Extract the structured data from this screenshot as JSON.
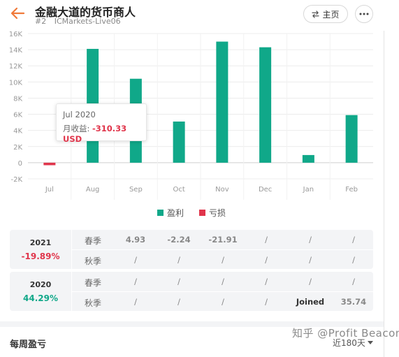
{
  "header": {
    "title": "金融大道的货币商人",
    "rank": "#2",
    "server": "ICMarkets-Live06",
    "home_label": "主页"
  },
  "chart_data": {
    "type": "bar",
    "categories": [
      "Jul",
      "Aug",
      "Sep",
      "Oct",
      "Nov",
      "Dec",
      "Jan",
      "Feb"
    ],
    "values": [
      -310.33,
      14100,
      10400,
      5100,
      15000,
      14300,
      950,
      5900
    ],
    "ylim": [
      -2000,
      16000
    ],
    "yticks": [
      16000,
      14000,
      12000,
      10000,
      8000,
      6000,
      4000,
      2000,
      0,
      -2000
    ],
    "ytick_labels": [
      "16K",
      "14K",
      "12K",
      "10K",
      "8K",
      "6K",
      "4K",
      "2K",
      "0",
      "-2K"
    ],
    "grid": true,
    "legend": [
      {
        "label": "盈利",
        "color": "#10a889"
      },
      {
        "label": "亏损",
        "color": "#e0354b"
      }
    ],
    "colors": {
      "profit": "#10a889",
      "loss": "#e0354b"
    }
  },
  "tooltip": {
    "month": "Jul 2020",
    "label": "月收益: ",
    "value": "-310.33 USD"
  },
  "returns_table": [
    {
      "year": "2021",
      "total": "-19.89%",
      "total_sign": "neg",
      "rows": [
        {
          "label": "春季",
          "cells": [
            {
              "text": "4.93",
              "kind": "pos"
            },
            {
              "text": "-2.24",
              "kind": "neg"
            },
            {
              "text": "-21.91",
              "kind": "neg"
            },
            {
              "text": "/",
              "kind": "empty"
            },
            {
              "text": "/",
              "kind": "empty"
            },
            {
              "text": "/",
              "kind": "empty"
            }
          ]
        },
        {
          "label": "秋季",
          "cells": [
            {
              "text": "/",
              "kind": "empty"
            },
            {
              "text": "/",
              "kind": "empty"
            },
            {
              "text": "/",
              "kind": "empty"
            },
            {
              "text": "/",
              "kind": "empty"
            },
            {
              "text": "/",
              "kind": "empty"
            },
            {
              "text": "/",
              "kind": "empty"
            }
          ]
        }
      ]
    },
    {
      "year": "2020",
      "total": "44.29%",
      "total_sign": "pos",
      "rows": [
        {
          "label": "春季",
          "cells": [
            {
              "text": "/",
              "kind": "empty"
            },
            {
              "text": "/",
              "kind": "empty"
            },
            {
              "text": "/",
              "kind": "empty"
            },
            {
              "text": "/",
              "kind": "empty"
            },
            {
              "text": "/",
              "kind": "empty"
            },
            {
              "text": "/",
              "kind": "empty"
            }
          ]
        },
        {
          "label": "秋季",
          "cells": [
            {
              "text": "/",
              "kind": "empty"
            },
            {
              "text": "/",
              "kind": "empty"
            },
            {
              "text": "/",
              "kind": "empty"
            },
            {
              "text": "/",
              "kind": "empty"
            },
            {
              "text": "Joined",
              "kind": "joined"
            },
            {
              "text": "35.74",
              "kind": "pos"
            }
          ]
        }
      ]
    }
  ],
  "weekly": {
    "title": "每周盈亏",
    "range": "近180天"
  },
  "watermark": "知乎 @Profit Beacon",
  "colors": {
    "accent": "#f07a3a",
    "profit": "#10a889",
    "loss": "#e0354b"
  }
}
